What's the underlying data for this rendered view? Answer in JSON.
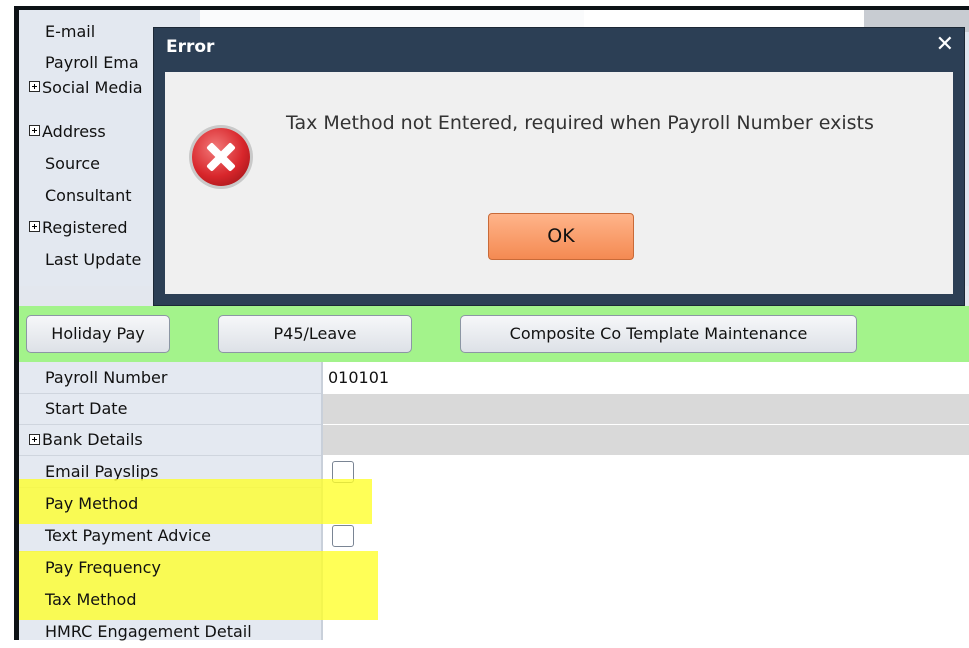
{
  "top_grid": {
    "rows": [
      {
        "label": "E-mail",
        "expandable": false
      },
      {
        "label": "Payroll Ema",
        "expandable": false
      },
      {
        "label": "Social Media",
        "expandable": true
      },
      {
        "label": "Address",
        "expandable": true
      },
      {
        "label": "Source",
        "expandable": false
      },
      {
        "label": "Consultant",
        "expandable": false
      },
      {
        "label": "Registered",
        "expandable": true
      },
      {
        "label": "Last Update",
        "expandable": false
      }
    ]
  },
  "toolbar": {
    "holiday_pay": "Holiday Pay",
    "p45_leave": "P45/Leave",
    "composite_template": "Composite Co Template Maintenance",
    "background_color": "#a3f38b"
  },
  "lower_grid": {
    "payroll_number": {
      "label": "Payroll Number",
      "value": "010101"
    },
    "start_date": {
      "label": "Start Date"
    },
    "bank_details": {
      "label": "Bank Details"
    },
    "email_payslips": {
      "label": "Email Payslips",
      "checked": false
    },
    "pay_method": {
      "label": "Pay Method"
    },
    "text_payment_advice": {
      "label": "Text Payment Advice",
      "checked": false
    },
    "pay_frequency": {
      "label": "Pay Frequency"
    },
    "tax_method": {
      "label": "Tax Method"
    },
    "hmrc": {
      "label": "HMRC Engagement Detail"
    }
  },
  "dialog": {
    "title": "Error",
    "close_glyph": "✕",
    "message": "Tax Method not Entered, required when Payroll Number exists",
    "ok_label": "OK",
    "icon": "error-icon"
  },
  "colors": {
    "highlight": "#ffff28",
    "dialog_frame": "#2c3f55",
    "ok_button": "#f48a52"
  }
}
